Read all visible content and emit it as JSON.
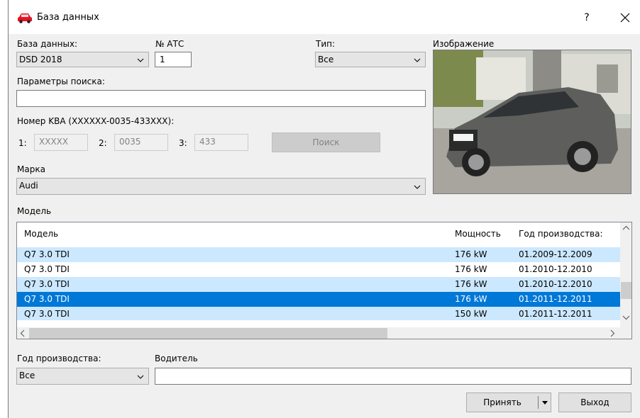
{
  "window": {
    "title": "База данных",
    "help_label": "?"
  },
  "database": {
    "label": "База данных:",
    "value": "DSD 2018"
  },
  "atc": {
    "label": "№ АТС",
    "value": "1"
  },
  "type": {
    "label": "Тип:",
    "value": "Все"
  },
  "image": {
    "label": "Изображение"
  },
  "search_params": {
    "label": "Параметры поиска:",
    "value": ""
  },
  "kba": {
    "label": "Номер KBA (XXXXXX-0035-433XXX):",
    "part1_label": "1:",
    "part1_value": "XXXXX",
    "part2_label": "2:",
    "part2_value": "0035",
    "part3_label": "3:",
    "part3_value": "433",
    "search_button": "Поиск"
  },
  "brand": {
    "label": "Марка",
    "value": "Audi"
  },
  "model_section": {
    "label": "Модель",
    "columns": [
      "Модель",
      "Мощность",
      "Год производства:"
    ],
    "rows": [
      {
        "model": "Q7 3.0 TDI",
        "power": "176 kW",
        "years": "01.2009-12.2009"
      },
      {
        "model": "Q7 3.0 TDI",
        "power": "176 kW",
        "years": "01.2010-12.2010"
      },
      {
        "model": "Q7 3.0 TDI",
        "power": "176 kW",
        "years": "01.2010-12.2010"
      },
      {
        "model": "Q7 3.0 TDI",
        "power": "176 kW",
        "years": "01.2011-12.2011"
      },
      {
        "model": "Q7 3.0 TDI",
        "power": "150 kW",
        "years": "01.2011-12.2011"
      }
    ],
    "selected_row": 3
  },
  "year_filter": {
    "label": "Год производства:",
    "value": "Все"
  },
  "driver": {
    "label": "Водитель",
    "value": ""
  },
  "buttons": {
    "accept": "Принять",
    "exit": "Выход"
  },
  "colors": {
    "accent": "#0078d7",
    "row_alt": "#cce8ff",
    "car_icon": "#e81123"
  }
}
